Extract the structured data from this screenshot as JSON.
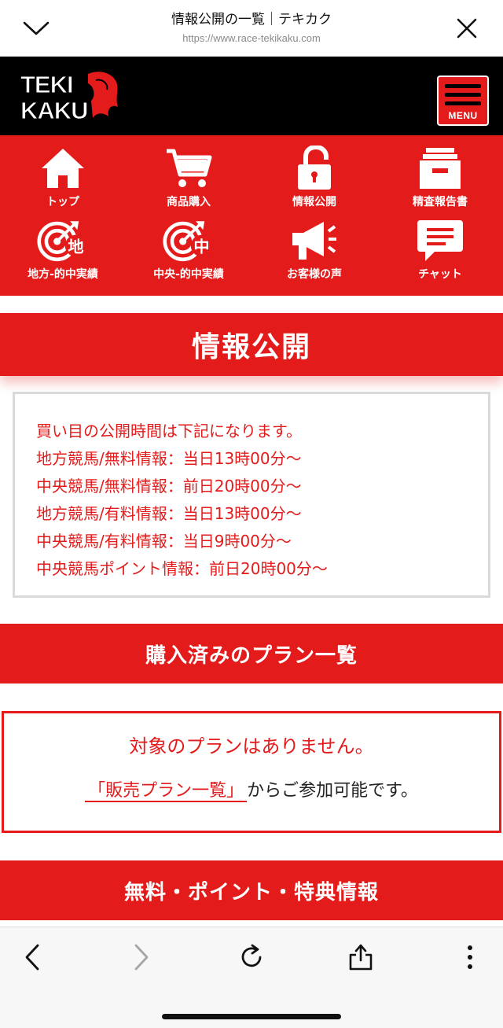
{
  "browser": {
    "title": "情報公開の一覧｜テキカク",
    "url": "https://www.race-tekikaku.com"
  },
  "header": {
    "logo_line1": "TEKI",
    "logo_line2": "KAKU",
    "menu_label": "MENU"
  },
  "nav": {
    "items": [
      {
        "label": "トップ",
        "icon": "home-icon"
      },
      {
        "label": "商品購入",
        "icon": "cart-icon"
      },
      {
        "label": "情報公開",
        "icon": "unlock-icon"
      },
      {
        "label": "精査報告書",
        "icon": "file-box-icon"
      },
      {
        "label": "地方-的中実績",
        "icon": "target-local-icon",
        "badge": "地"
      },
      {
        "label": "中央-的中実績",
        "icon": "target-central-icon",
        "badge": "中"
      },
      {
        "label": "お客様の声",
        "icon": "megaphone-icon"
      },
      {
        "label": "チャット",
        "icon": "chat-icon"
      }
    ]
  },
  "page": {
    "title": "情報公開"
  },
  "info": {
    "lines": [
      "買い目の公開時間は下記になります。",
      "地方競馬/無料情報：当日13時00分～",
      "中央競馬/無料情報：前日20時00分～",
      "地方競馬/有料情報：当日13時00分～",
      "中央競馬/有料情報：当日9時00分～",
      "中央競馬ポイント情報：前日20時00分～"
    ]
  },
  "purchased": {
    "heading": "購入済みのプラン一覧",
    "empty_message": "対象のプランはありません。",
    "link_text": "「販売プラン一覧」",
    "cta_suffix": "からご参加可能です。"
  },
  "free_section": {
    "heading": "無料・ポイント・特典情報"
  },
  "colors": {
    "brand_red": "#e31b1b",
    "header_black": "#000000"
  }
}
